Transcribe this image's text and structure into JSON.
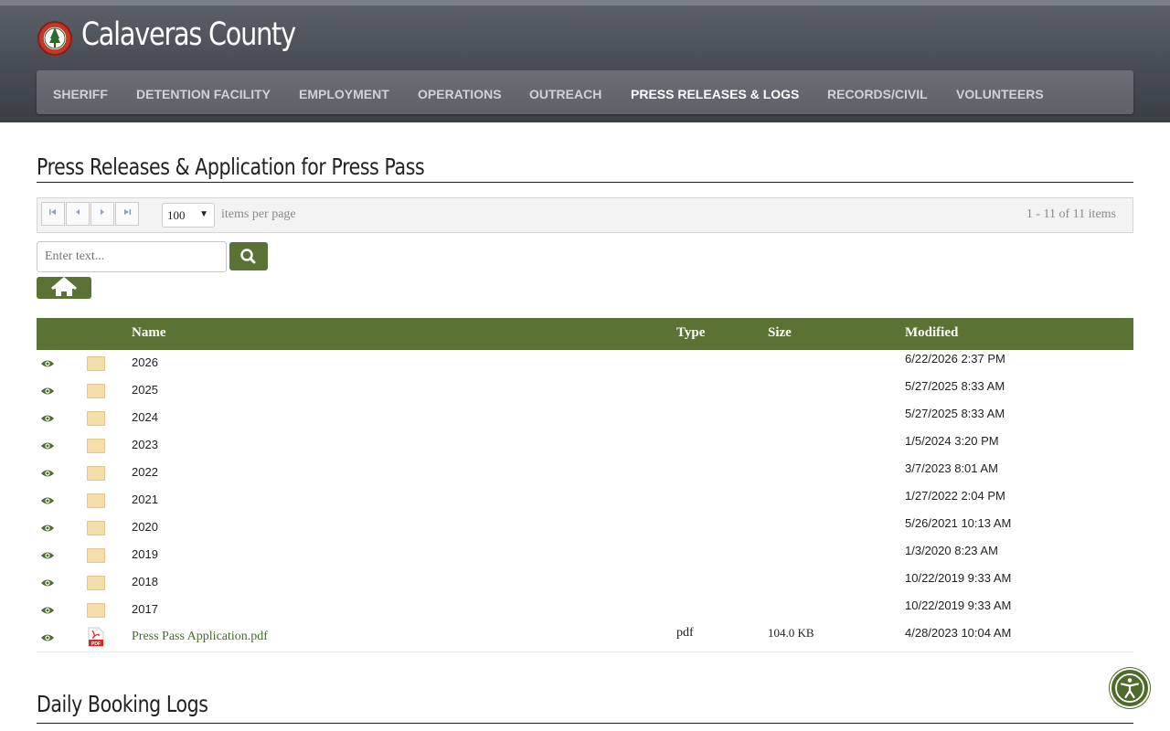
{
  "site": {
    "title": "Calaveras County"
  },
  "nav": {
    "items": [
      "SHERIFF",
      "DETENTION FACILITY",
      "EMPLOYMENT",
      "OPERATIONS",
      "OUTREACH",
      "PRESS RELEASES & LOGS",
      "RECORDS/CIVIL",
      "VOLUNTEERS"
    ],
    "active": "PRESS RELEASES & LOGS"
  },
  "section1": {
    "title": "Press Releases & Application for Press Pass"
  },
  "pager": {
    "per_page_value": "100",
    "per_page_label": "items per page",
    "info": "1 - 11 of 11 items",
    "buttons": [
      "first-page",
      "previous-page",
      "next-page",
      "last-page"
    ]
  },
  "search": {
    "placeholder": "Enter text..."
  },
  "table": {
    "headers": {
      "name": "Name",
      "type": "Type",
      "size": "Size",
      "modified": "Modified"
    },
    "rows": [
      {
        "icon": "folder-icon",
        "name": "2026",
        "type": "",
        "size": "",
        "modified": "6/22/2026 2:37 PM"
      },
      {
        "icon": "folder-icon",
        "name": "2025",
        "type": "",
        "size": "",
        "modified": "5/27/2025 8:33 AM"
      },
      {
        "icon": "folder-icon",
        "name": "2024",
        "type": "",
        "size": "",
        "modified": "5/27/2025 8:33 AM"
      },
      {
        "icon": "folder-icon",
        "name": "2023",
        "type": "",
        "size": "",
        "modified": "1/5/2024 3:20 PM"
      },
      {
        "icon": "folder-icon",
        "name": "2022",
        "type": "",
        "size": "",
        "modified": "3/7/2023 8:01 AM"
      },
      {
        "icon": "folder-icon",
        "name": "2021",
        "type": "",
        "size": "",
        "modified": "1/27/2022 2:04 PM"
      },
      {
        "icon": "folder-icon",
        "name": "2020",
        "type": "",
        "size": "",
        "modified": "5/26/2021 10:13 AM"
      },
      {
        "icon": "folder-icon",
        "name": "2019",
        "type": "",
        "size": "",
        "modified": "1/3/2020 8:23 AM"
      },
      {
        "icon": "folder-icon",
        "name": "2018",
        "type": "",
        "size": "",
        "modified": "10/22/2019 9:33 AM"
      },
      {
        "icon": "folder-icon",
        "name": "2017",
        "type": "",
        "size": "",
        "modified": "10/22/2019 9:33 AM"
      },
      {
        "icon": "pdf-icon",
        "name": "Press Pass Application.pdf",
        "type": "pdf",
        "size": "104.0 KB",
        "modified": "4/28/2023 10:04 AM"
      }
    ]
  },
  "section2": {
    "title": "Daily Booking Logs"
  },
  "colors": {
    "brand_green": "#5a7335",
    "header_gray": "#4a4f57",
    "link_green": "#4a6b2a"
  }
}
